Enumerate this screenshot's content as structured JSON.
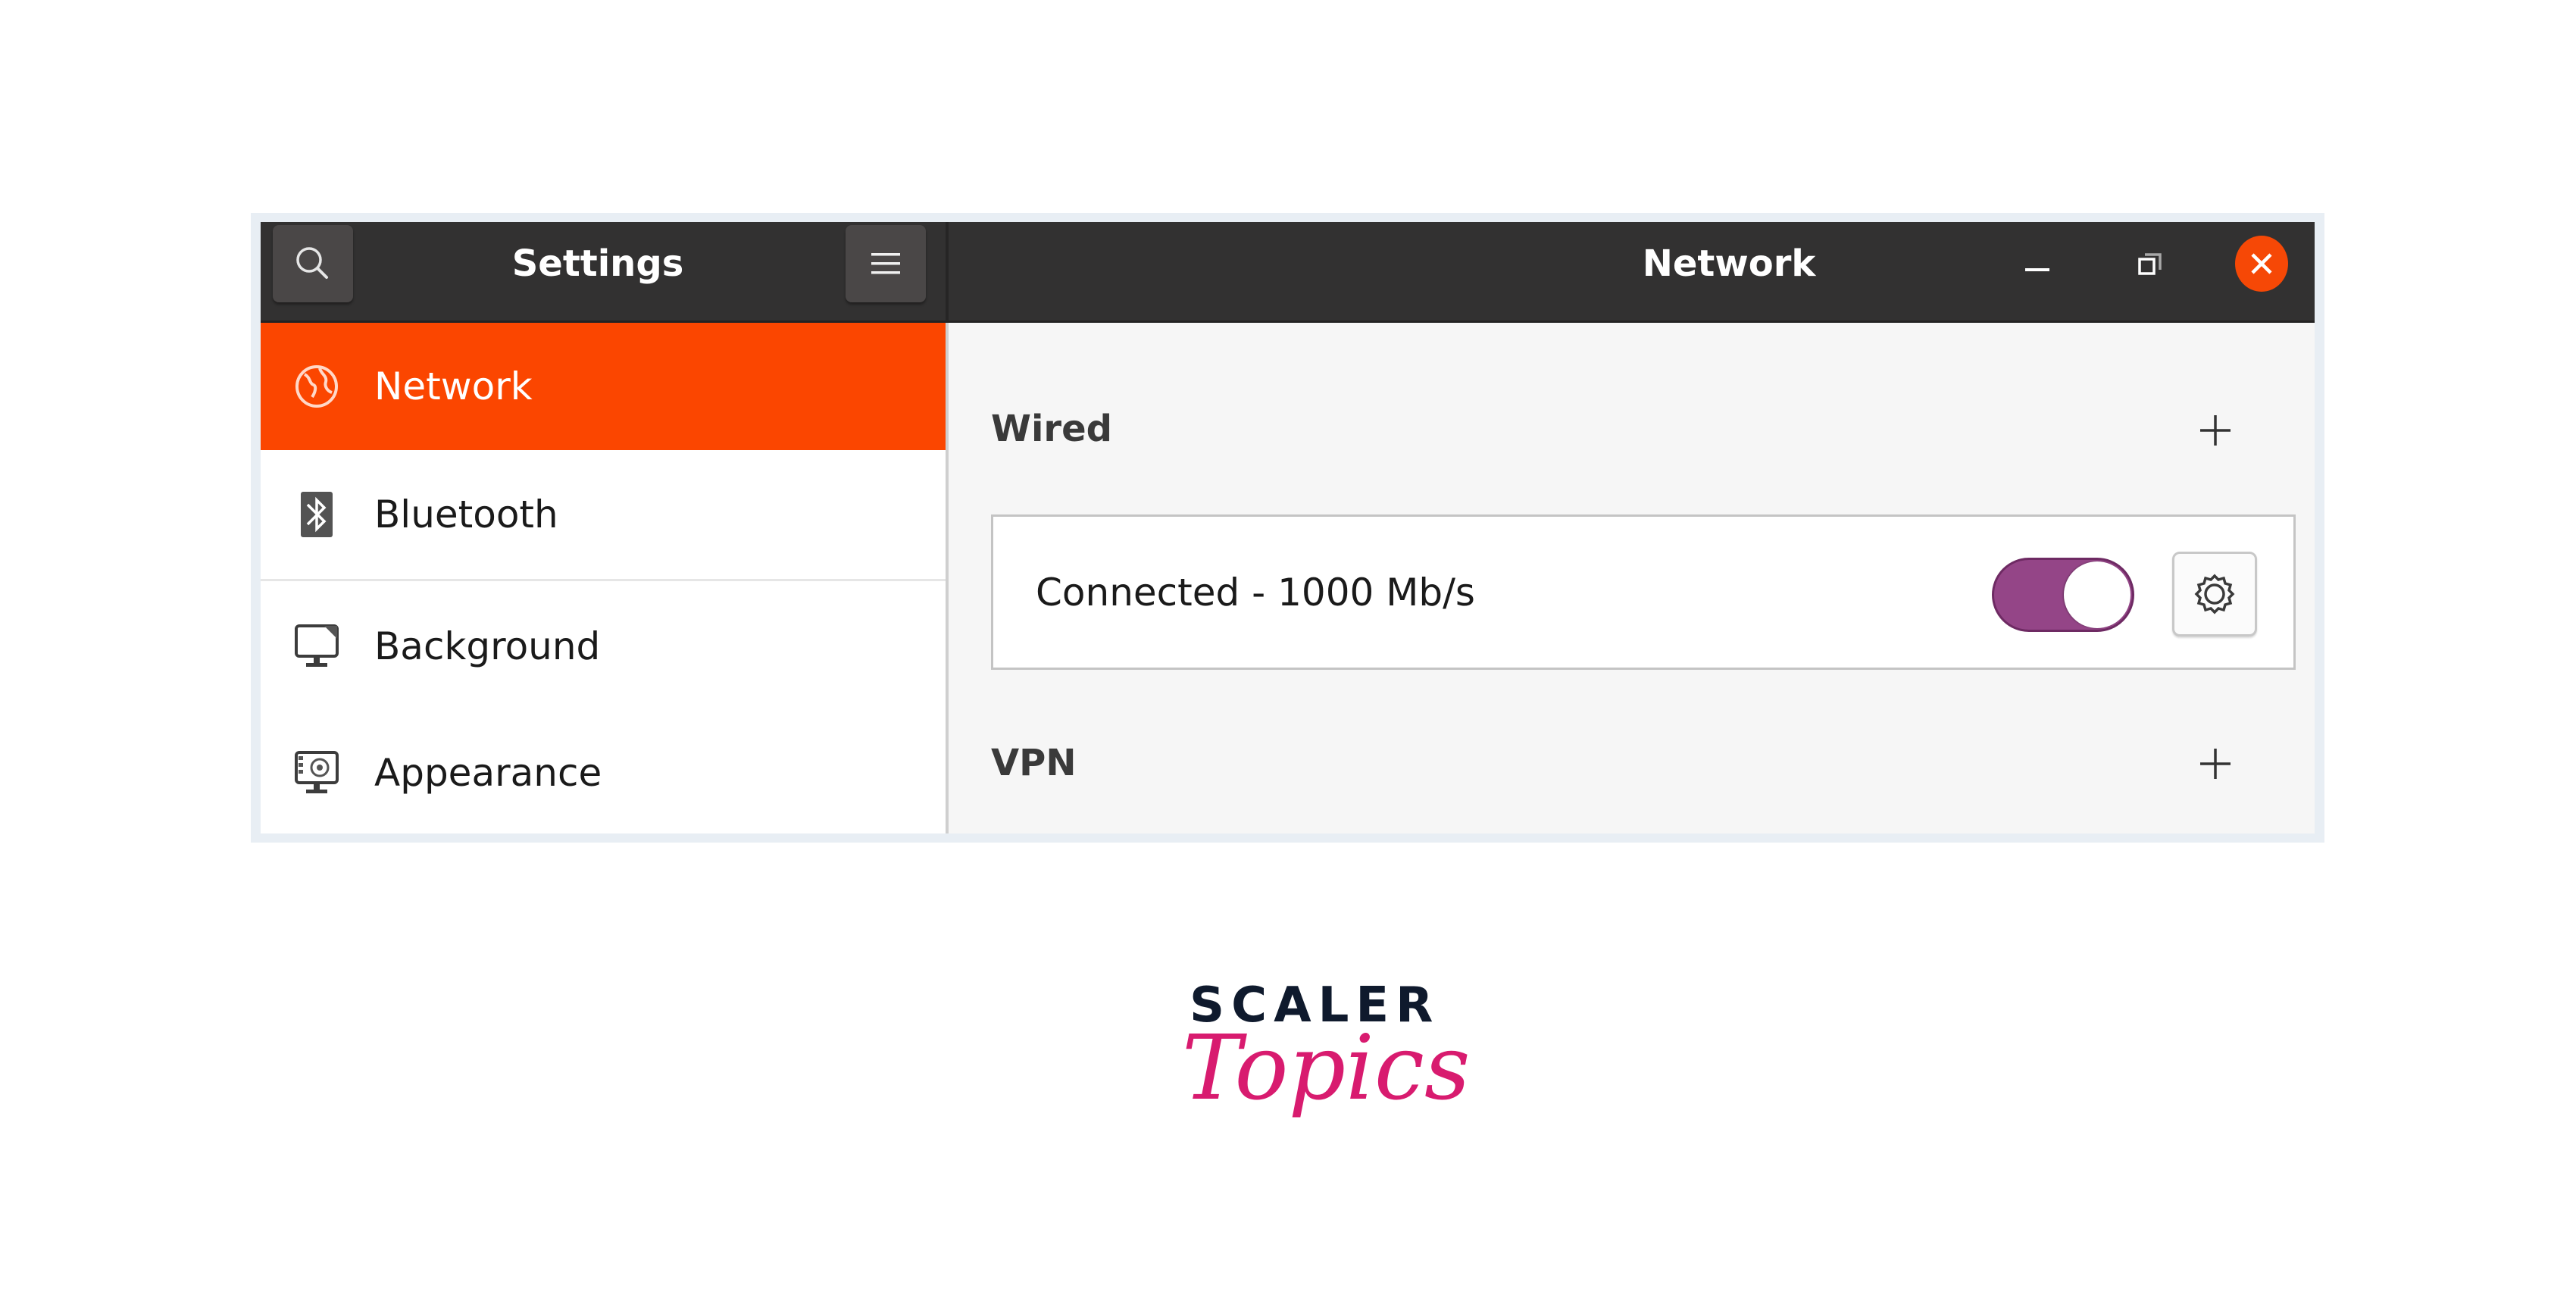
{
  "header": {
    "left_title": "Settings",
    "right_title": "Network",
    "search_icon": "search-icon",
    "menu_icon": "hamburger-menu-icon",
    "window_controls": [
      "minimize-icon",
      "restore-icon",
      "close-icon"
    ]
  },
  "sidebar": {
    "items": [
      {
        "label": "Network",
        "icon": "globe-icon",
        "active": true
      },
      {
        "label": "Bluetooth",
        "icon": "bluetooth-icon",
        "active": false
      },
      {
        "label": "Background",
        "icon": "monitor-wallpaper-icon",
        "active": false
      },
      {
        "label": "Appearance",
        "icon": "monitor-appearance-icon",
        "active": false
      }
    ]
  },
  "main": {
    "sections": [
      {
        "title": "Wired",
        "add_icon": "plus-icon"
      },
      {
        "title": "VPN",
        "add_icon": "plus-icon"
      }
    ],
    "wired_connection": {
      "status": "Connected - 1000 Mb/s",
      "enabled": true,
      "settings_icon": "gear-icon"
    }
  },
  "colors": {
    "accent": "#fb4600",
    "header_bg": "#323131",
    "toggle_on": "#944587",
    "close_button": "#f64806",
    "logo_topics": "#d81b6f",
    "logo_scaler": "#0f1a2d"
  },
  "logo": {
    "line1": "SCALER",
    "line2": "Topics"
  }
}
